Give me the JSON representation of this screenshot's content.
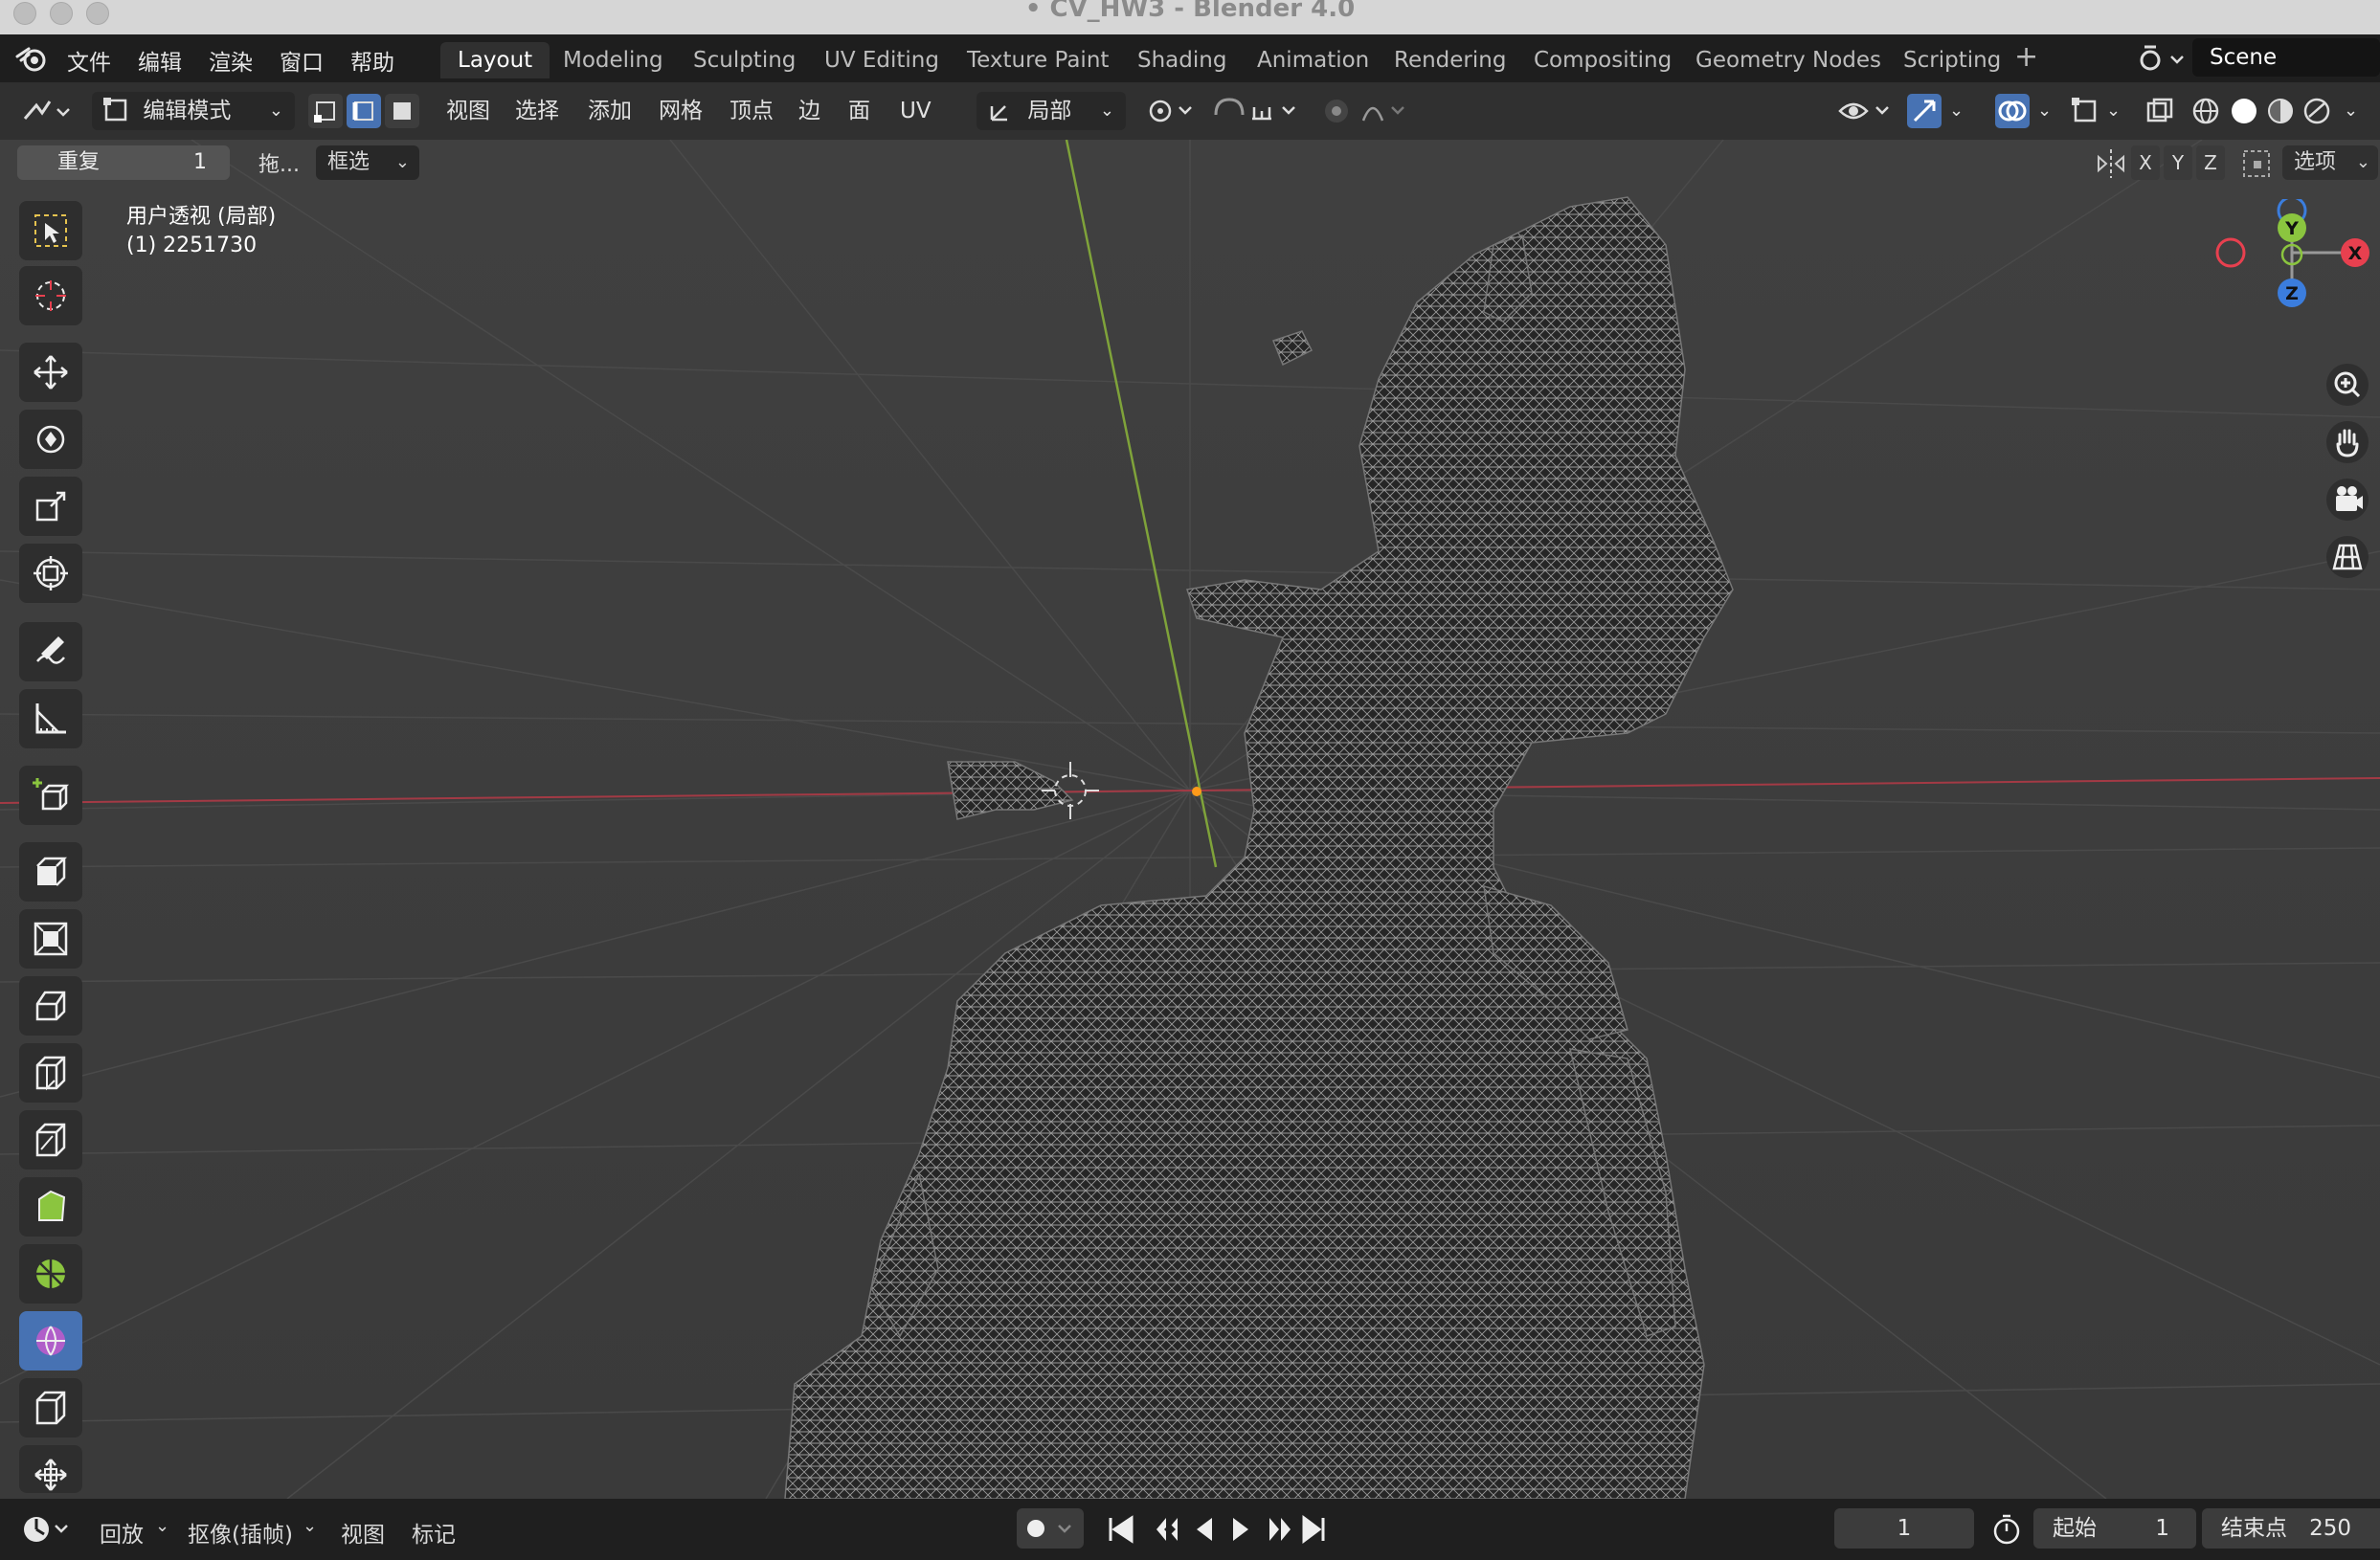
{
  "window": {
    "title": "• CV_HW3 - Blender 4.0"
  },
  "menu": [
    "文件",
    "编辑",
    "渲染",
    "窗口",
    "帮助"
  ],
  "workspace_tabs": [
    {
      "label": "Layout",
      "active": true
    },
    {
      "label": "Modeling"
    },
    {
      "label": "Sculpting"
    },
    {
      "label": "UV Editing"
    },
    {
      "label": "Texture Paint"
    },
    {
      "label": "Shading"
    },
    {
      "label": "Animation"
    },
    {
      "label": "Rendering"
    },
    {
      "label": "Compositing"
    },
    {
      "label": "Geometry Nodes"
    },
    {
      "label": "Scripting"
    }
  ],
  "scene": {
    "name": "Scene"
  },
  "header": {
    "mode": "编辑模式",
    "menus": [
      "视图",
      "选择",
      "添加",
      "网格",
      "顶点",
      "边",
      "面",
      "UV"
    ],
    "transform_orientation": "局部"
  },
  "tool_settings": {
    "repeat_label": "重复",
    "repeat_value": "1",
    "drag_label": "拖...",
    "select_mode": "框选",
    "axes": [
      "X",
      "Y",
      "Z"
    ],
    "options": "选项"
  },
  "viewport": {
    "view_name": "用户透视 (局部)",
    "object_info": "(1) 2251730",
    "gizmo_axes": [
      "Y",
      "X",
      "Z"
    ]
  },
  "timeline": {
    "playback": "回放",
    "keying": "抠像(插帧)",
    "view": "视图",
    "marker": "标记",
    "current_frame": "1",
    "start_label": "起始",
    "start": "1",
    "end_label": "结束点",
    "end": "250"
  },
  "colors": {
    "accent": "#4772b3",
    "axis_x": "#e8404f",
    "axis_y": "#8bc53f",
    "axis_z": "#3b7ddd"
  }
}
